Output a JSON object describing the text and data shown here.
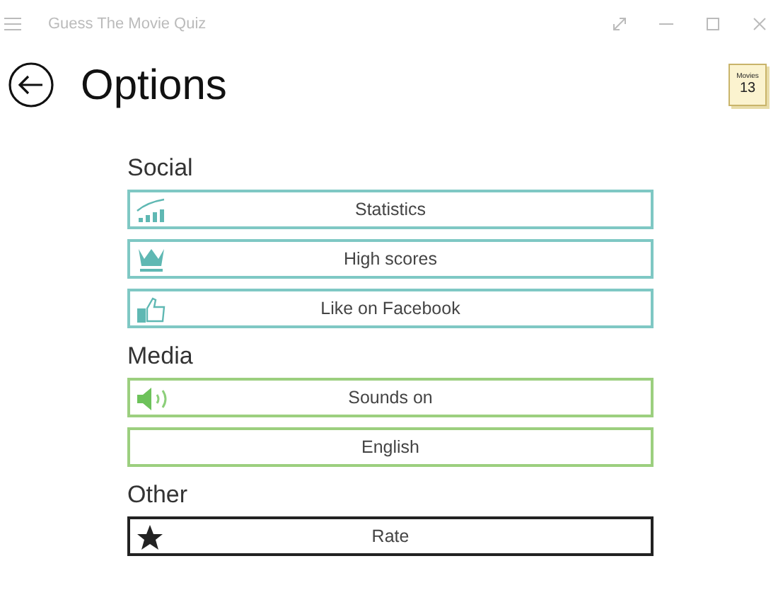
{
  "window": {
    "title": "Guess The Movie Quiz"
  },
  "page": {
    "title": "Options"
  },
  "badge": {
    "label": "Movies",
    "count": "13"
  },
  "sections": [
    {
      "heading": "Social",
      "items": [
        {
          "label": "Statistics",
          "kind": "stats",
          "color": "#7fc8c4"
        },
        {
          "label": "High scores",
          "kind": "crown",
          "color": "#7fc8c4"
        },
        {
          "label": "Like on Facebook",
          "kind": "thumb",
          "color": "#7fc8c4"
        }
      ]
    },
    {
      "heading": "Media",
      "items": [
        {
          "label": "Sounds on",
          "kind": "speaker",
          "color": "#9ccf7f"
        },
        {
          "label": "English",
          "kind": "plain",
          "color": "#9ccf7f"
        }
      ]
    },
    {
      "heading": "Other",
      "items": [
        {
          "label": "Rate",
          "kind": "star",
          "color": "#222222"
        }
      ]
    }
  ]
}
